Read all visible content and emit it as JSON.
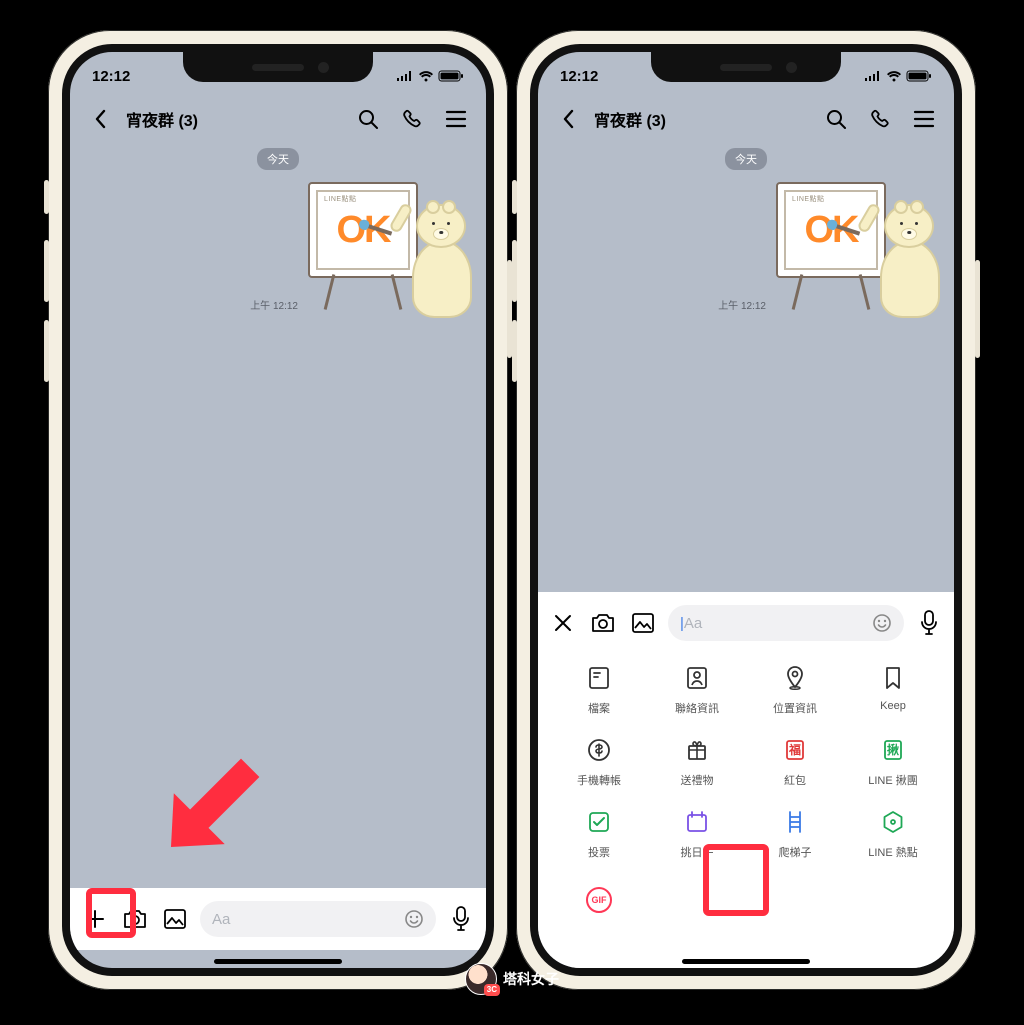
{
  "status": {
    "time": "12:12"
  },
  "header": {
    "title": "宵夜群 (3)"
  },
  "chat": {
    "date_pill": "今天",
    "msg_time": "上午 12:12",
    "sticker_text": "OK",
    "sticker_label": "LINE點點"
  },
  "input": {
    "placeholder": "Aa"
  },
  "panel": {
    "items": [
      {
        "key": "file",
        "label": "檔案"
      },
      {
        "key": "contact",
        "label": "聯絡資訊"
      },
      {
        "key": "location",
        "label": "位置資訊"
      },
      {
        "key": "keep",
        "label": "Keep"
      },
      {
        "key": "transfer",
        "label": "手機轉帳"
      },
      {
        "key": "gift",
        "label": "送禮物"
      },
      {
        "key": "envelope",
        "label": "紅包",
        "badge": "福"
      },
      {
        "key": "group",
        "label": "LINE 揪團",
        "badge": "揪"
      },
      {
        "key": "vote",
        "label": "投票"
      },
      {
        "key": "date",
        "label": "挑日子"
      },
      {
        "key": "ladder",
        "label": "爬梯子"
      },
      {
        "key": "hotspot",
        "label": "LINE 熱點"
      }
    ],
    "gif_label": "GIF"
  },
  "watermark": {
    "text": "塔科女子"
  }
}
